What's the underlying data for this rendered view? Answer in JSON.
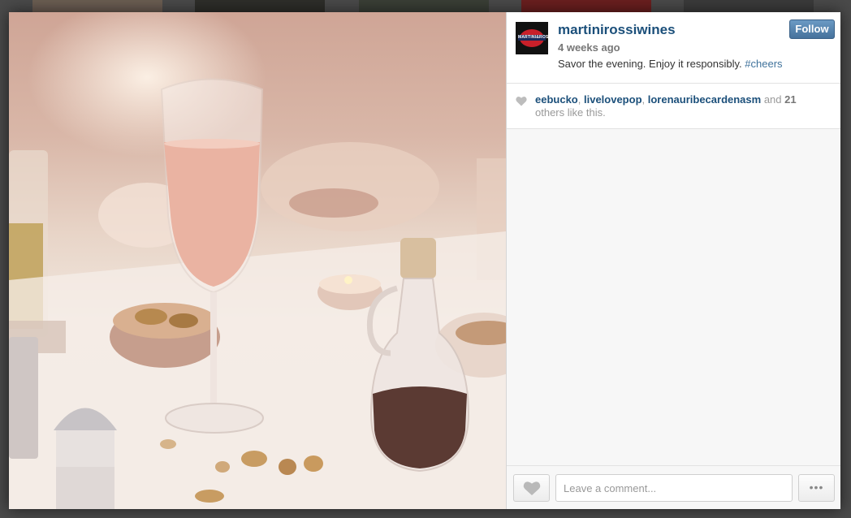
{
  "post": {
    "username": "martinirossiwines",
    "avatar_text": "MARTINI&ROSSI",
    "timestamp": "4 weeks ago",
    "caption_text": "Savor the evening. Enjoy it responsibly.",
    "hashtag": "#cheers",
    "follow_label": "Follow"
  },
  "likes": {
    "user1": "eebucko",
    "user2": "livelovepop",
    "user3": "lorenauribecardenasm",
    "and_text": "and",
    "count": "21",
    "suffix": "others like this."
  },
  "comment": {
    "placeholder": "Leave a comment...",
    "more_label": "•••"
  },
  "colors": {
    "username": "#1b4f7a",
    "hashtag": "#3f729b",
    "follow_button": "#4f7ea8",
    "panel_bg": "#f7f7f7"
  },
  "icons": {
    "like_list": "heart-icon",
    "like_button": "heart-icon",
    "more": "ellipsis-icon"
  }
}
